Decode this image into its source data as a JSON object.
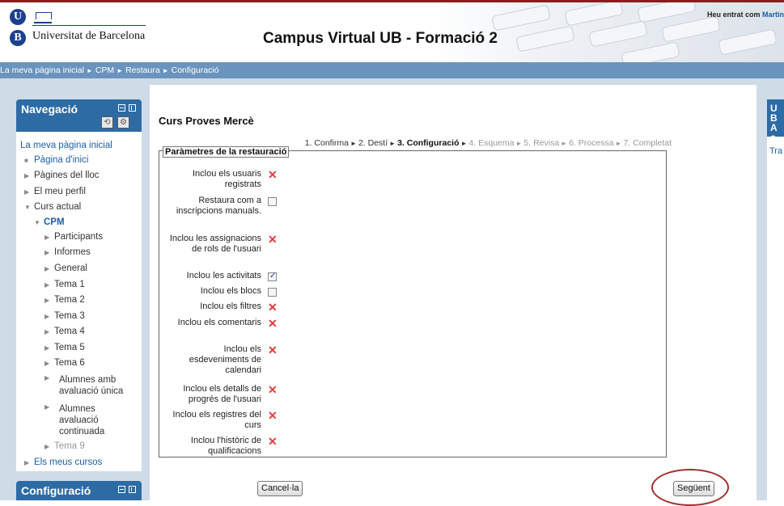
{
  "header": {
    "logo_text": "Universitat de Barcelona",
    "site_title": "Campus Virtual UB - Formació 2",
    "login_prefix": "Heu entrat com",
    "login_user": "Martin"
  },
  "breadcrumb": {
    "items": [
      "La meva pàgina inicial",
      "CPM",
      "Restaura",
      "Configuració"
    ],
    "separator": "►"
  },
  "navigation": {
    "title": "Navegació",
    "home": "La meva pàgina inicial",
    "items": [
      {
        "label": "Pàgina d'inici",
        "marker": "■"
      },
      {
        "label": "Pàgines del lloc",
        "marker": "▶"
      },
      {
        "label": "El meu perfil",
        "marker": "▶"
      },
      {
        "label": "Curs actual",
        "marker": "▼"
      },
      {
        "label": "CPM",
        "marker": "▼"
      },
      {
        "label": "Participants",
        "marker": "▶"
      },
      {
        "label": "Informes",
        "marker": "▶"
      },
      {
        "label": "General",
        "marker": "▶"
      },
      {
        "label": "Tema 1",
        "marker": "▶"
      },
      {
        "label": "Tema 2",
        "marker": "▶"
      },
      {
        "label": "Tema 3",
        "marker": "▶"
      },
      {
        "label": "Tema 4",
        "marker": "▶"
      },
      {
        "label": "Tema 5",
        "marker": "▶"
      },
      {
        "label": "Tema 6",
        "marker": "▶"
      },
      {
        "label": "Alumnes amb avaluació única",
        "marker": "▶"
      },
      {
        "label": "Alumnes avaluació continuada",
        "marker": "▶"
      },
      {
        "label": "Tema 9",
        "marker": "▶"
      },
      {
        "label": "Els meus cursos",
        "marker": "▶"
      }
    ]
  },
  "config_block": {
    "title": "Configuració"
  },
  "main": {
    "course_title": "Curs Proves Mercè",
    "steps": [
      {
        "label": "1. Confirma",
        "state": "done"
      },
      {
        "label": "2. Destí",
        "state": "done"
      },
      {
        "label": "3. Configuració",
        "state": "current"
      },
      {
        "label": "4. Esquema",
        "state": "todo"
      },
      {
        "label": "5. Revisa",
        "state": "todo"
      },
      {
        "label": "6. Processa",
        "state": "todo"
      },
      {
        "label": "7. Completat",
        "state": "todo"
      }
    ],
    "step_separator": "►",
    "legend": "Paràmetres de la restauració",
    "settings": [
      {
        "label": "Inclou els usuaris registrats",
        "state": "locked"
      },
      {
        "label": "Restaura com a inscripcions manuals.",
        "state": "unchecked"
      },
      {
        "label": "Inclou les assignacions de rols de l'usuari",
        "state": "locked"
      },
      {
        "label": "Inclou les activitats",
        "state": "checked"
      },
      {
        "label": "Inclou els blocs",
        "state": "unchecked"
      },
      {
        "label": "Inclou els filtres",
        "state": "locked"
      },
      {
        "label": "Inclou els comentaris",
        "state": "locked"
      },
      {
        "label": "Inclou els esdeveniments de calendari",
        "state": "locked"
      },
      {
        "label": "Inclou els detalls de progrés de l'usuari",
        "state": "locked"
      },
      {
        "label": "Inclou els registres del curs",
        "state": "locked"
      },
      {
        "label": "Inclou l'històric de qualificacions",
        "state": "locked"
      }
    ],
    "cancel_label": "Cancel·la",
    "next_label": "Següent"
  },
  "right_block": {
    "title": "UB Ac",
    "link": "Tra"
  },
  "colors": {
    "accent": "#2d6ba5",
    "breadcrumb_bg": "#6a94bd",
    "locked_mark": "#e23b3b",
    "highlight_circle": "#a32b2b"
  }
}
